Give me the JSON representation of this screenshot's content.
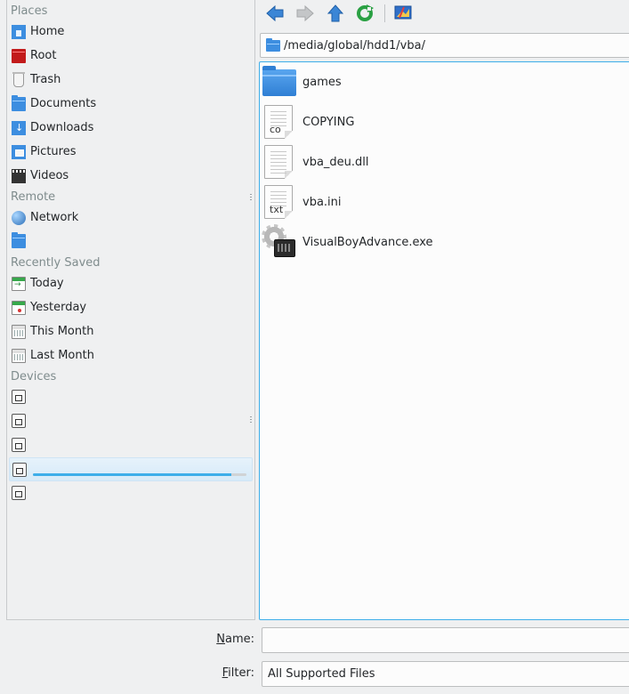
{
  "places": {
    "sections": {
      "places": "Places",
      "remote": "Remote",
      "recently_saved": "Recently Saved",
      "devices": "Devices"
    },
    "items": {
      "home": "Home",
      "root": "Root",
      "trash": "Trash",
      "documents": "Documents",
      "downloads": "Downloads",
      "pictures": "Pictures",
      "videos": "Videos",
      "network": "Network",
      "today": "Today",
      "yesterday": "Yesterday",
      "this_month": "This Month",
      "last_month": "Last Month"
    },
    "selected_device_capacity_used": 0.93
  },
  "toolbar": {
    "buttons": [
      "back-icon",
      "forward-icon",
      "up-icon",
      "reload-icon",
      "preview-icon"
    ],
    "accent": "#3daee9"
  },
  "location": {
    "path": "/media/global/hdd1/vba/"
  },
  "files": [
    {
      "name": "games",
      "icon": "folder-icon"
    },
    {
      "name": "COPYING",
      "icon": "text-file-icon",
      "ext": "co"
    },
    {
      "name": "vba_deu.dll",
      "icon": "library-file-icon"
    },
    {
      "name": "vba.ini",
      "icon": "text-file-icon",
      "ext": "txt"
    },
    {
      "name": "VisualBoyAdvance.exe",
      "icon": "executable-icon"
    }
  ],
  "form": {
    "name_label_mnemonic": "N",
    "name_label_rest": "ame:",
    "name_value": "",
    "filter_label_mnemonic": "F",
    "filter_label_rest": "ilter:",
    "filter_value": "All Supported Files"
  }
}
